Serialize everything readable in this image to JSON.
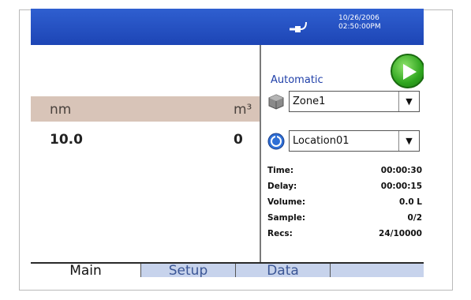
{
  "status_bar": {
    "date": "10/26/2006",
    "time": "02:50:00PM",
    "connection_icon": "plug-icon",
    "color": "#2a55c6"
  },
  "table": {
    "headers": [
      "nm",
      "m³"
    ],
    "values": [
      "10.0",
      "0"
    ]
  },
  "right_pane": {
    "mode": "Automatic",
    "start_icon": "play-icon",
    "zone": {
      "icon": "cube-icon",
      "value": "Zone1"
    },
    "location": {
      "icon": "location-icon",
      "value": "Location01"
    },
    "stats": [
      {
        "key": "Time:",
        "value": "00:00:30"
      },
      {
        "key": "Delay:",
        "value": "00:00:15"
      },
      {
        "key": "Volume:",
        "value": "0.0 L"
      },
      {
        "key": "Sample:",
        "value": "0/2"
      },
      {
        "key": "Recs:",
        "value": "24/10000"
      }
    ]
  },
  "tabs": [
    "Main",
    "Setup",
    "Data"
  ],
  "active_tab": "Main"
}
